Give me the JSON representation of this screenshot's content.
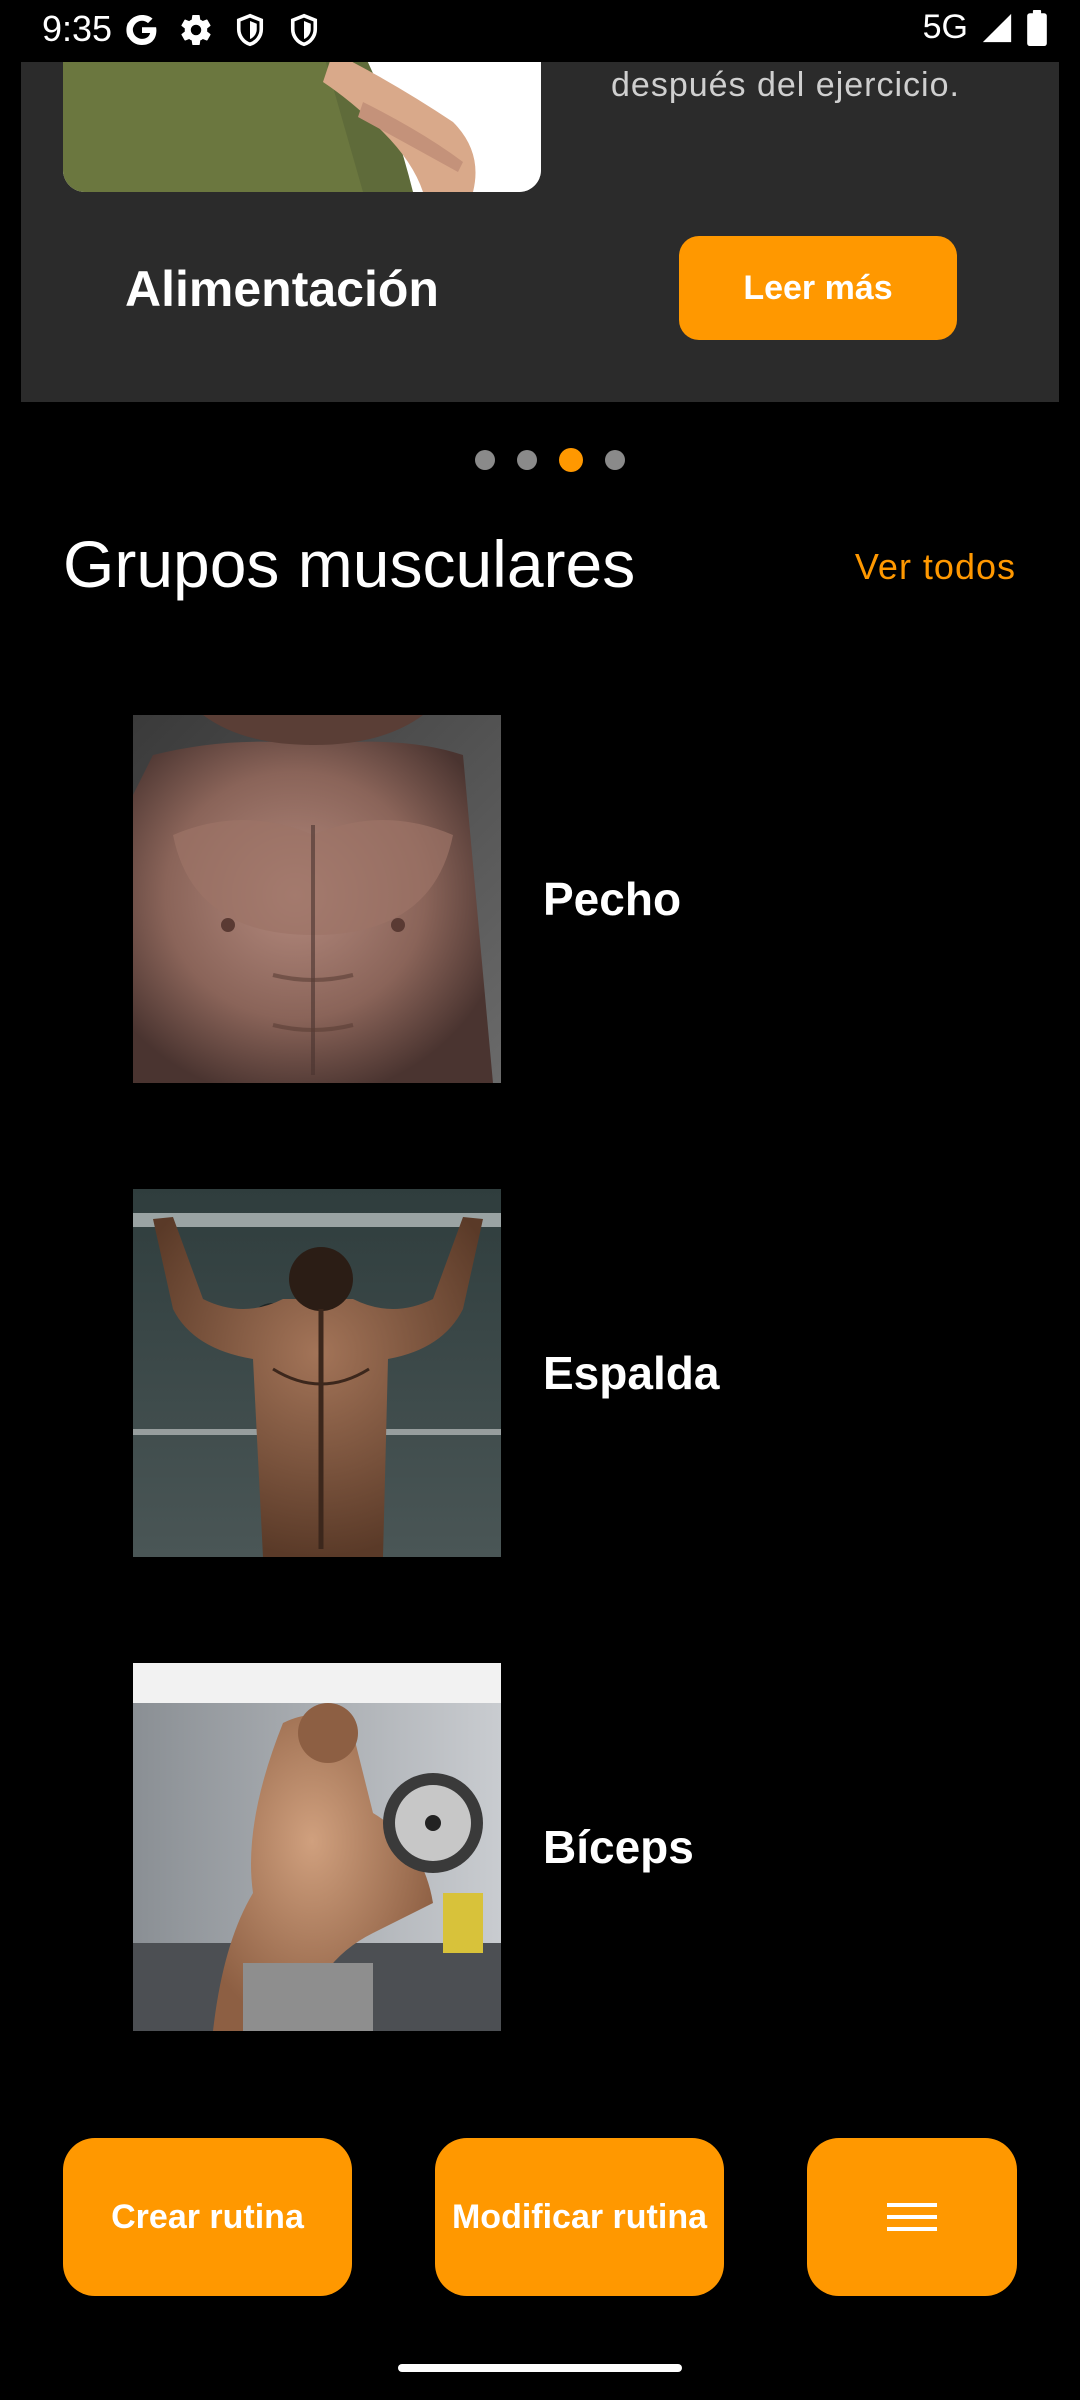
{
  "status_bar": {
    "time": "9:35",
    "network": "5G"
  },
  "carousel": {
    "snippet": "después del ejercicio.",
    "category": "Alimentación",
    "read_more_label": "Leer más",
    "total_pages": 4,
    "active_page": 3
  },
  "section": {
    "title": "Grupos musculares",
    "see_all_label": "Ver todos"
  },
  "muscle_groups": [
    {
      "name": "Pecho"
    },
    {
      "name": "Espalda"
    },
    {
      "name": "Bíceps"
    }
  ],
  "bottom_bar": {
    "create_label": "Crear rutina",
    "modify_label": "Modificar rutina",
    "menu_icon": "hamburger-menu-icon"
  },
  "colors": {
    "accent": "#ff9800",
    "card_bg": "#2b2b2b",
    "background": "#000000"
  }
}
